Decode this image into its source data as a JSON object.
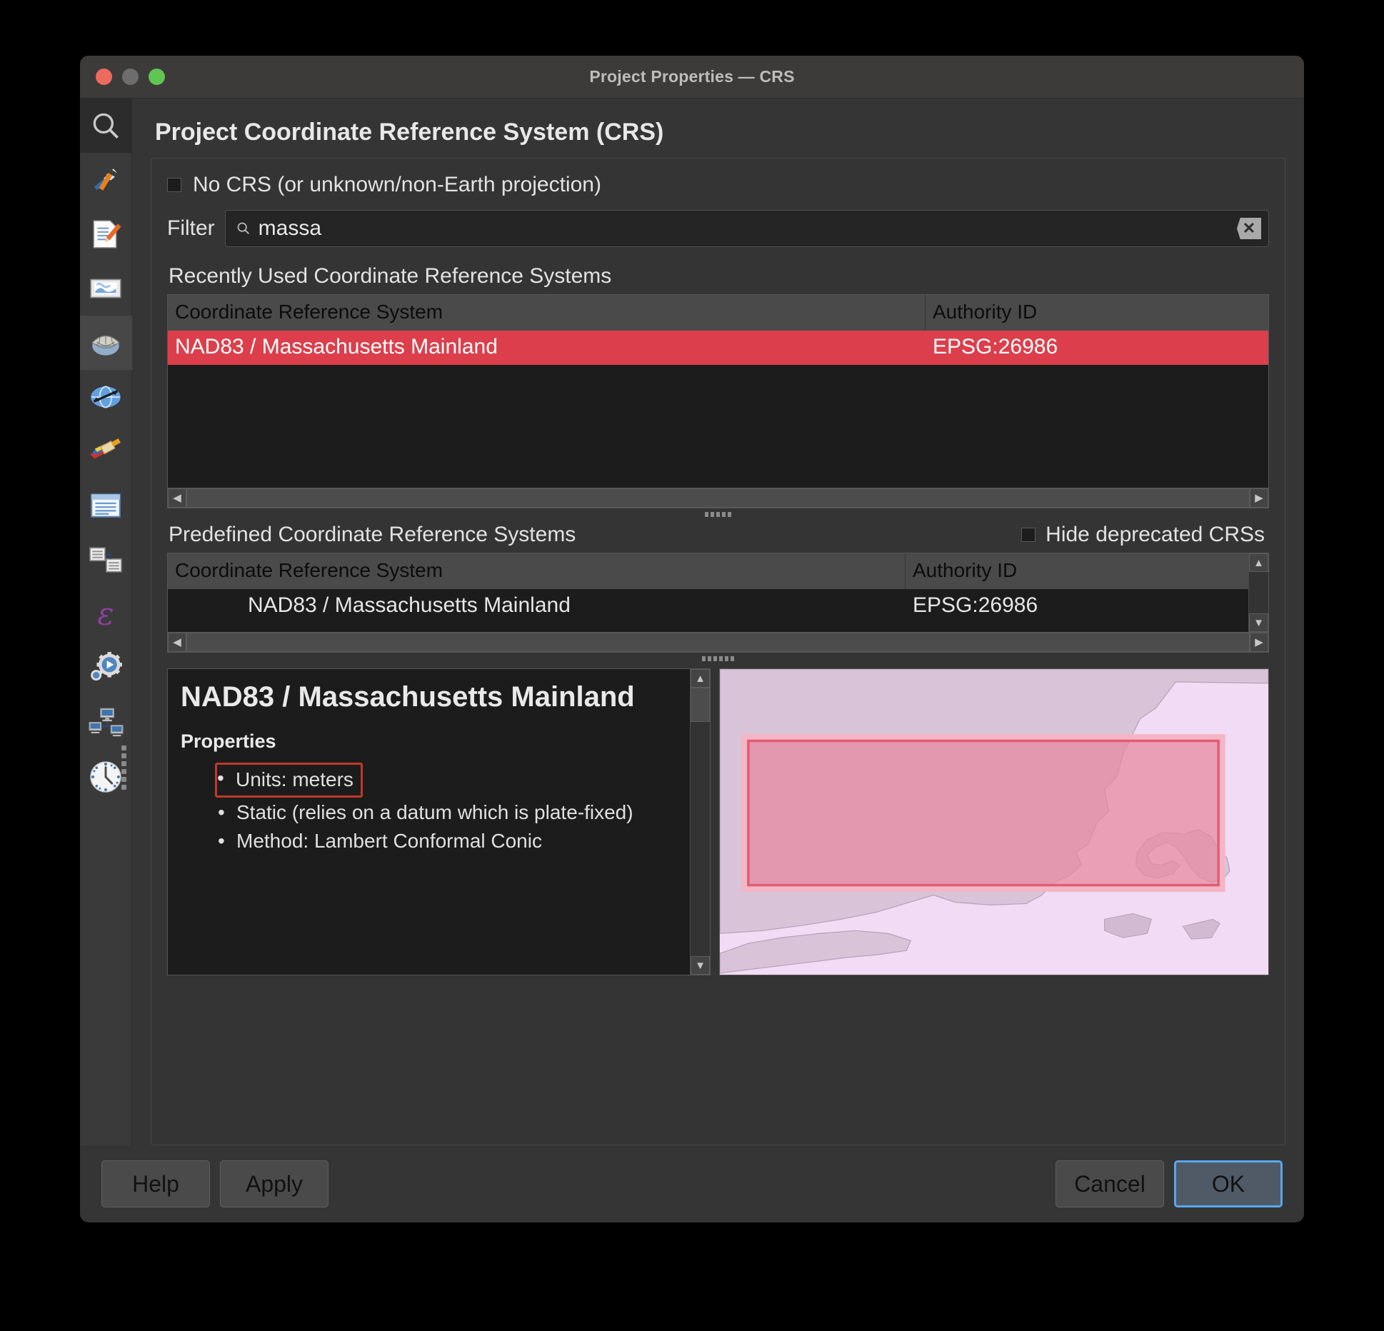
{
  "window": {
    "title": "Project Properties — CRS",
    "traffic_lights": [
      "close",
      "minimize",
      "zoom"
    ]
  },
  "sidebar": {
    "items": [
      {
        "name": "search",
        "icon": "search-icon",
        "label": "Search"
      },
      {
        "name": "general",
        "icon": "tools-icon",
        "label": "General"
      },
      {
        "name": "metadata",
        "icon": "document-pencil-icon",
        "label": "Metadata"
      },
      {
        "name": "view-settings",
        "icon": "map-canvas-icon",
        "label": "View Settings"
      },
      {
        "name": "crs",
        "icon": "globe-grid-icon",
        "label": "CRS"
      },
      {
        "name": "transformations",
        "icon": "globe-arrows-icon",
        "label": "Transformations"
      },
      {
        "name": "styles",
        "icon": "paint-brush-icon",
        "label": "Styles"
      },
      {
        "name": "data-sources",
        "icon": "table-icon",
        "label": "Data Sources"
      },
      {
        "name": "relations",
        "icon": "relations-icon",
        "label": "Relations"
      },
      {
        "name": "variables",
        "icon": "epsilon-icon",
        "label": "Variables"
      },
      {
        "name": "macros",
        "icon": "gear-play-icon",
        "label": "Macros"
      },
      {
        "name": "qgis-server",
        "icon": "network-icon",
        "label": "QGIS Server"
      },
      {
        "name": "temporal",
        "icon": "clock-icon",
        "label": "Temporal"
      }
    ],
    "selected": "crs"
  },
  "page": {
    "title": "Project Coordinate Reference System (CRS)"
  },
  "no_crs": {
    "label": "No CRS (or unknown/non-Earth projection)",
    "checked": false
  },
  "filter": {
    "label": "Filter",
    "value": "massa",
    "placeholder": "",
    "search_icon": "search-icon",
    "clear_icon": "clear-icon"
  },
  "recently_used": {
    "heading": "Recently Used Coordinate Reference Systems",
    "columns": [
      "Coordinate Reference System",
      "Authority ID"
    ],
    "rows": [
      {
        "crs": "NAD83 / Massachusetts Mainland",
        "authority": "EPSG:26986",
        "selected": true
      }
    ]
  },
  "predefined": {
    "heading": "Predefined Coordinate Reference Systems",
    "hide_deprecated": {
      "label": "Hide deprecated CRSs",
      "checked": false
    },
    "columns": [
      "Coordinate Reference System",
      "Authority ID"
    ],
    "rows": [
      {
        "crs": "NAD83 / Massachusetts Mainland",
        "authority": "EPSG:26986",
        "selected": false
      }
    ]
  },
  "description": {
    "title": "NAD83 / Massachusetts Mainland",
    "subtitle": "Properties",
    "properties": [
      {
        "text": "Units: meters",
        "annotated": true
      },
      {
        "text": "Static (relies on a datum which is plate-fixed)",
        "annotated": false
      },
      {
        "text": "Method: Lambert Conformal Conic",
        "annotated": false
      }
    ]
  },
  "preview": {
    "name": "crs-extent-preview-map",
    "extent_fill": "#e8889e",
    "extent_stroke": "#e45b72",
    "land_color": "#d9c3d9",
    "water_color": "#f0daf2"
  },
  "buttons": {
    "help": "Help",
    "apply": "Apply",
    "cancel": "Cancel",
    "ok": "OK"
  },
  "colors": {
    "selection_red": "#dc3f4b",
    "focus_blue": "#5aa6f0",
    "annotation_red": "#c0392b",
    "window_bg": "#353535"
  }
}
